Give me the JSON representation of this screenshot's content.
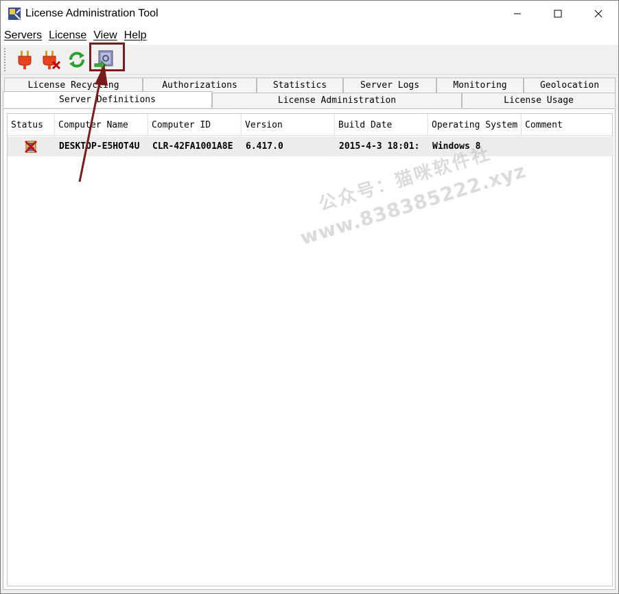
{
  "window": {
    "title": "License Administration Tool",
    "controls": {
      "minimize": "—",
      "maximize": "☐",
      "close": "✕"
    }
  },
  "menu": [
    {
      "label": "Servers"
    },
    {
      "label": "License"
    },
    {
      "label": "View"
    },
    {
      "label": "Help"
    }
  ],
  "toolbar": {
    "buttons": [
      {
        "icon": "plug-connect-icon"
      },
      {
        "icon": "plug-disconnect-icon"
      },
      {
        "icon": "refresh-icon"
      },
      {
        "icon": "server-settings-icon",
        "highlighted": true
      }
    ]
  },
  "tabs": {
    "row1": [
      "License Recycling",
      "Authorizations",
      "Statistics",
      "Server Logs",
      "Monitoring",
      "Geolocation"
    ],
    "row2": [
      "Server Definitions",
      "License Administration",
      "License Usage"
    ],
    "active": "Server Definitions"
  },
  "table": {
    "columns": [
      "Status",
      "Computer Name",
      "Computer ID",
      "Version",
      "Build Date",
      "Operating System",
      "Comment"
    ],
    "rows": [
      {
        "status_icon": "server-disconnected-icon",
        "computer_name": "DESKTOP-E5HOT4U",
        "computer_id": "CLR-42FA1001A8E",
        "version": "6.417.0",
        "build_date": "2015-4-3 18:01:",
        "os": "Windows 8",
        "comment": ""
      }
    ]
  },
  "watermark": {
    "line1": "公众号：猫咪软件社",
    "line2": "www.838385222.xyz"
  },
  "colors": {
    "annotation": "#7a1a1a",
    "window_bg": "#f0f0f0",
    "selected_row": "#ececec"
  }
}
